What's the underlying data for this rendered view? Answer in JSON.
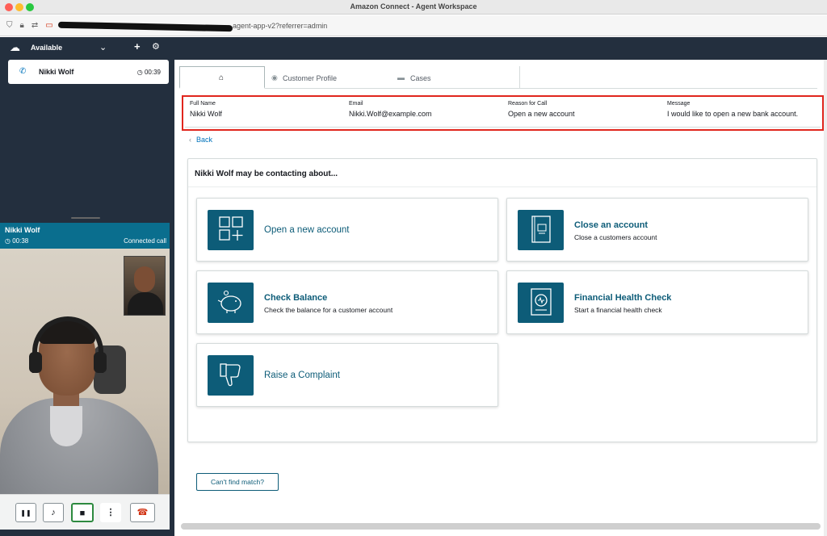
{
  "window": {
    "title": "Amazon Connect - Agent Workspace"
  },
  "browser": {
    "url_suffix": "agent-app-v2?referrer=admin"
  },
  "agent": {
    "status": "Available"
  },
  "contact": {
    "name": "Nikki Wolf",
    "timer": "00:39"
  },
  "call": {
    "name": "Nikki Wolf",
    "timer": "00:38",
    "status": "Connected call"
  },
  "call_controls": [
    {
      "name": "pause-icon",
      "symbol": "❚❚"
    },
    {
      "name": "microphone-icon",
      "symbol": "🎤"
    },
    {
      "name": "video-camera-icon",
      "symbol": "■"
    },
    {
      "name": "more-options-icon",
      "symbol": "⋮"
    },
    {
      "name": "hang-up-icon",
      "symbol": "☎"
    }
  ],
  "tabs": {
    "home_icon": "home-icon",
    "profile": "Customer Profile",
    "cases": "Cases"
  },
  "customer": {
    "full_name_label": "Full Name",
    "full_name": "Nikki Wolf",
    "email_label": "Email",
    "email": "Nikki.Wolf@example.com",
    "reason_label": "Reason for Call",
    "reason": "Open a new account",
    "message_label": "Message",
    "message": "I would like to open a new bank account."
  },
  "nav": {
    "back": "Back"
  },
  "panel": {
    "title": "Nikki Wolf may be contacting about..."
  },
  "cards": [
    {
      "title": "Open a new account",
      "description": "",
      "icon": "grid-add-icon"
    },
    {
      "title": "Close an account",
      "description": "Close a customers account",
      "icon": "notebook-icon"
    },
    {
      "title": "Check Balance",
      "description": "Check the balance for a customer account",
      "icon": "piggy-bank-icon"
    },
    {
      "title": "Financial Health Check",
      "description": "Start a financial health check",
      "icon": "health-check-icon"
    },
    {
      "title": "Raise a Complaint",
      "description": "",
      "icon": "thumbs-down-icon"
    }
  ],
  "cant_find": "Can't find match?",
  "colors": {
    "accent": "#0d5c78",
    "dark_nav": "#232f3e",
    "highlight_border": "#e0261d",
    "call_header": "#0a6e8e"
  }
}
